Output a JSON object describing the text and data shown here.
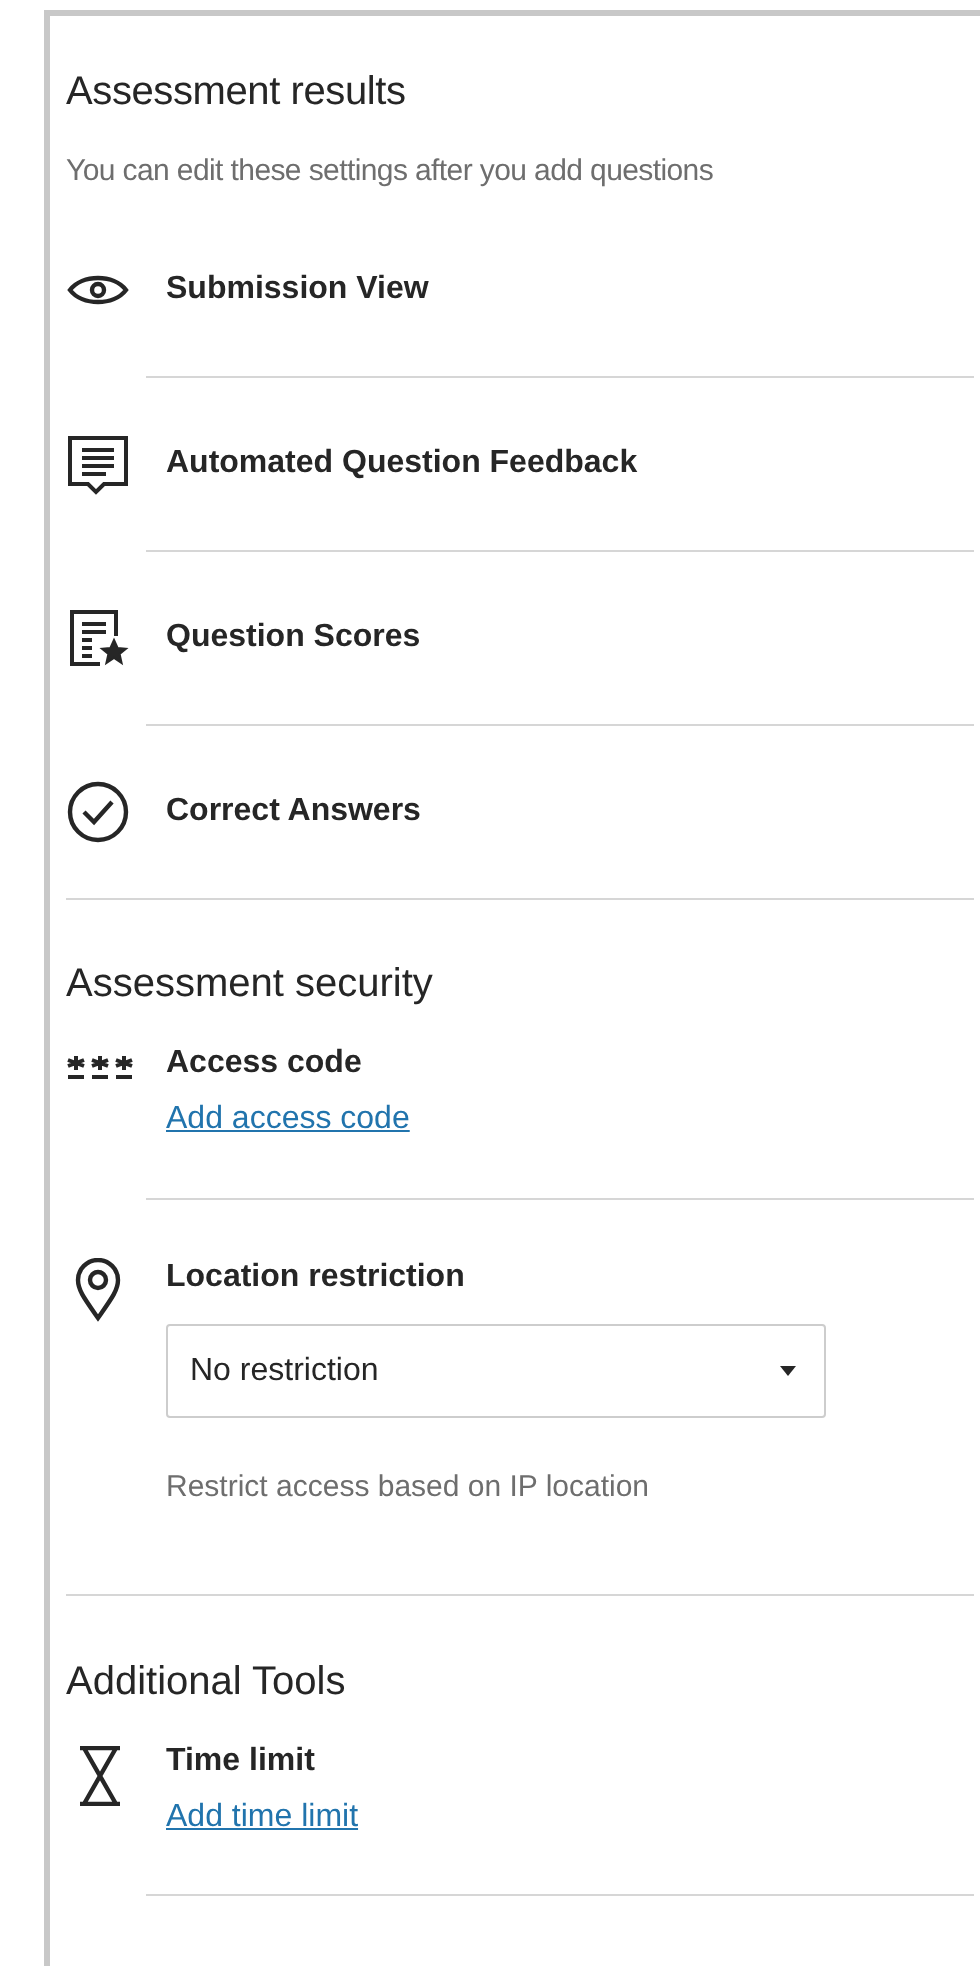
{
  "results": {
    "title": "Assessment results",
    "subtitle": "You can edit these settings after you add questions",
    "items": [
      {
        "label": "Submission View"
      },
      {
        "label": "Automated Question Feedback"
      },
      {
        "label": "Question Scores"
      },
      {
        "label": "Correct Answers"
      }
    ]
  },
  "security": {
    "title": "Assessment security",
    "access_code": {
      "label": "Access code",
      "link": "Add access code"
    },
    "location": {
      "label": "Location restriction",
      "select_value": "No restriction",
      "help": "Restrict access based on IP location"
    }
  },
  "tools": {
    "title": "Additional Tools",
    "time_limit": {
      "label": "Time limit",
      "link": "Add time limit"
    }
  }
}
